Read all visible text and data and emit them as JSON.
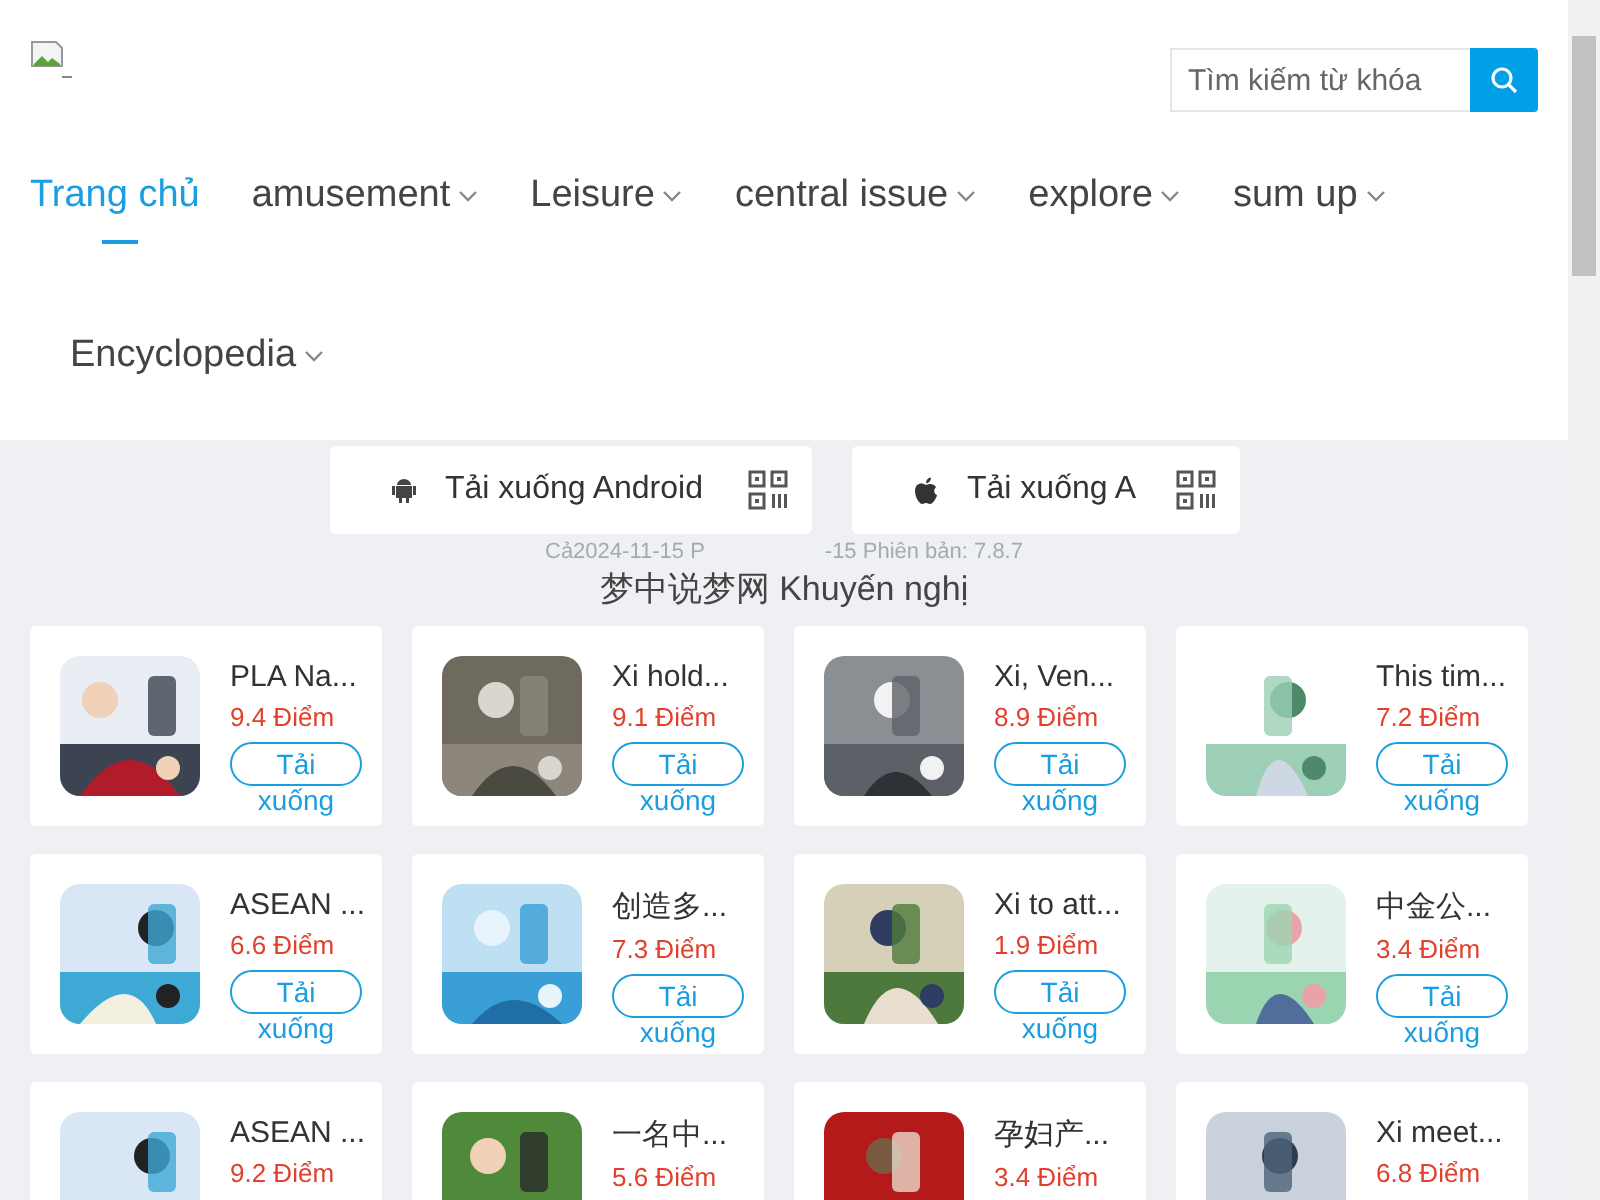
{
  "search": {
    "placeholder": "Tìm kiếm từ khóa"
  },
  "nav": [
    {
      "label": "Trang chủ",
      "selected": true,
      "dropdown": false
    },
    {
      "label": "amusement",
      "selected": false,
      "dropdown": true
    },
    {
      "label": "Leisure",
      "selected": false,
      "dropdown": true
    },
    {
      "label": "central issue",
      "selected": false,
      "dropdown": true
    },
    {
      "label": "explore",
      "selected": false,
      "dropdown": true
    },
    {
      "label": "sum up",
      "selected": false,
      "dropdown": true
    },
    {
      "label": "Encyclopedia",
      "selected": false,
      "dropdown": true
    }
  ],
  "downloads": [
    {
      "kind": "android",
      "label": "Tải xuống Android"
    },
    {
      "kind": "apple",
      "label": "Tải xuống A"
    }
  ],
  "version_left": "Cả2024-11-15 P",
  "version_right": "-15 Phiên bản: 7.8.7",
  "heading": "梦中说梦网 Khuyến nghị",
  "apps": [
    {
      "title": "PLA Na...",
      "score": "9.4 Điểm",
      "button": "Tải xuống"
    },
    {
      "title": "Xi hold...",
      "score": "9.1 Điểm",
      "button": "Tải xuống"
    },
    {
      "title": "Xi, Ven...",
      "score": "8.9 Điểm",
      "button": "Tải xuống"
    },
    {
      "title": "This tim...",
      "score": "7.2 Điểm",
      "button": "Tải xuống"
    },
    {
      "title": "ASEAN ...",
      "score": "6.6 Điểm",
      "button": "Tải xuống"
    },
    {
      "title": "创造多...",
      "score": "7.3 Điểm",
      "button": "Tải xuống"
    },
    {
      "title": "Xi to att...",
      "score": "1.9 Điểm",
      "button": "Tải xuống"
    },
    {
      "title": "中金公...",
      "score": "3.4 Điểm",
      "button": "Tải xuống"
    },
    {
      "title": "ASEAN ...",
      "score": "9.2 Điểm"
    },
    {
      "title": "一名中...",
      "score": "5.6 Điểm"
    },
    {
      "title": "孕妇产...",
      "score": "3.4 Điểm"
    },
    {
      "title": "Xi meet...",
      "score": "6.8 Điểm"
    }
  ]
}
